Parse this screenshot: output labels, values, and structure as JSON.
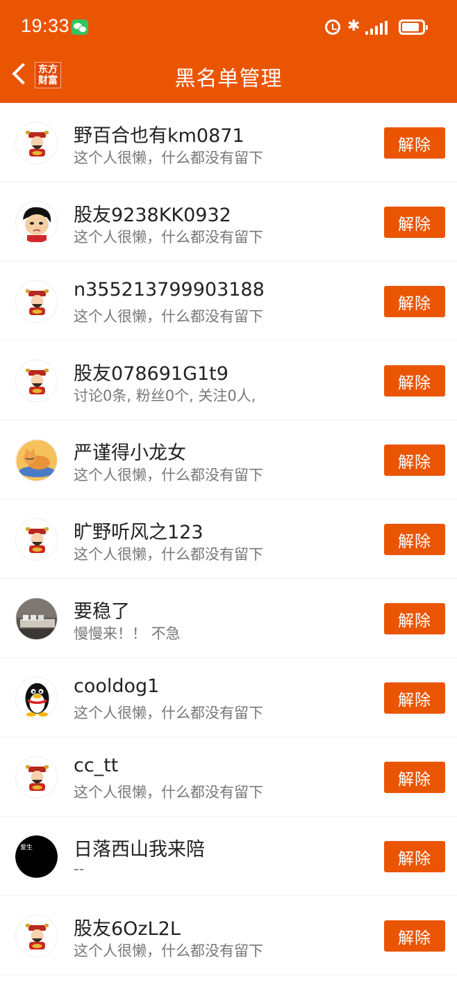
{
  "status_bar": {
    "time": "19:33"
  },
  "header": {
    "title": "黑名单管理",
    "logo_line1": "东方",
    "logo_line2": "财富"
  },
  "unblock_label": "解除",
  "rows": [
    {
      "name": "野百合也有km0871",
      "desc": "这个人很懒，什么都没有留下",
      "avatar": "fortune-god"
    },
    {
      "name": "股友9238KK0932",
      "desc": "这个人很懒，什么都没有留下",
      "avatar": "cartoon-man"
    },
    {
      "name": "n355213799903188",
      "desc": "这个人很懒，什么都没有留下",
      "avatar": "fortune-god"
    },
    {
      "name": "股友078691G1t9",
      "desc": "讨论0条, 粉丝0个, 关注0人,",
      "avatar": "fortune-god"
    },
    {
      "name": "严谨得小龙女",
      "desc": "这个人很懒，什么都没有留下",
      "avatar": "cat"
    },
    {
      "name": "旷野听风之123",
      "desc": "这个人很懒，什么都没有留下",
      "avatar": "fortune-god"
    },
    {
      "name": "要稳了",
      "desc": "慢慢来！！ 不急",
      "avatar": "photo"
    },
    {
      "name": "cooldog1",
      "desc": "这个人很懒，什么都没有留下",
      "avatar": "penguin"
    },
    {
      "name": "cc_tt",
      "desc": "这个人很懒，什么都没有留下",
      "avatar": "fortune-god"
    },
    {
      "name": "日落西山我来陪",
      "desc": "--",
      "avatar": "black-circle",
      "avatar_text": "爱生"
    },
    {
      "name": "股友6OzL2L",
      "desc": "这个人很懒，什么都没有留下",
      "avatar": "fortune-god"
    }
  ],
  "colors": {
    "brand": "#EA5504"
  }
}
